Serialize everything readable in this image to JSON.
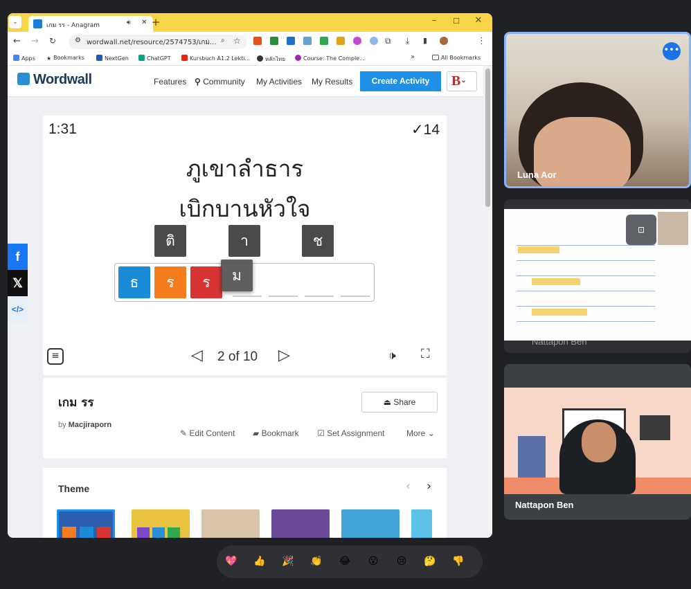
{
  "browser": {
    "tab_title": "เกม รร - Anagram",
    "new_tab": "+",
    "url": "wordwall.net/resource/2574753/เกม...",
    "bookmarks": [
      "Apps",
      "Bookmarks",
      "NextGen",
      "ChatGPT",
      "Kursbuch A1.2 Lekti...",
      "หลักไทย",
      "Course: The Comple..."
    ],
    "all_bookmarks": "All Bookmarks",
    "more_bookmarks": "»"
  },
  "wordwall": {
    "logo": "Wordwall",
    "nav": [
      "Features",
      "Community",
      "My Activities",
      "My Results"
    ],
    "create_button": "Create Activity",
    "user_initial": "B"
  },
  "game": {
    "timer": "1:31",
    "score": "14",
    "prompt_line1": "ภูเขาลำธาร",
    "prompt_line2": "เบิกบานหัวใจ",
    "loose_tiles": [
      "ติ",
      "า",
      "ช"
    ],
    "placed_tiles": [
      "ธ",
      "ร",
      "ร"
    ],
    "dragging_tile": "ม",
    "pagination": "2 of 10"
  },
  "activity": {
    "title": "เกม รร",
    "by_label": "by",
    "author": "Macjiraporn",
    "share": "Share",
    "actions": [
      "Edit Content",
      "Bookmark",
      "Set Assignment",
      "More"
    ]
  },
  "theme": {
    "label": "Theme"
  },
  "meet": {
    "participants": [
      {
        "name": "Luna Aor"
      },
      {
        "name": "Nattapon Ben"
      },
      {
        "name": "Nattapon Ben"
      }
    ],
    "reactions": [
      "💖",
      "👍",
      "🎉",
      "👏",
      "😂",
      "😮",
      "😢",
      "🤔",
      "👎"
    ]
  },
  "colors": {
    "tab_strip": "#f8d548",
    "create_button": "#1e90e6",
    "tile_blue": "#1a8bd6",
    "tile_orange": "#f57c1f",
    "tile_red": "#d93434",
    "tile_gray": "#4a4a4a",
    "active_speaker": "#8ab4f8"
  }
}
